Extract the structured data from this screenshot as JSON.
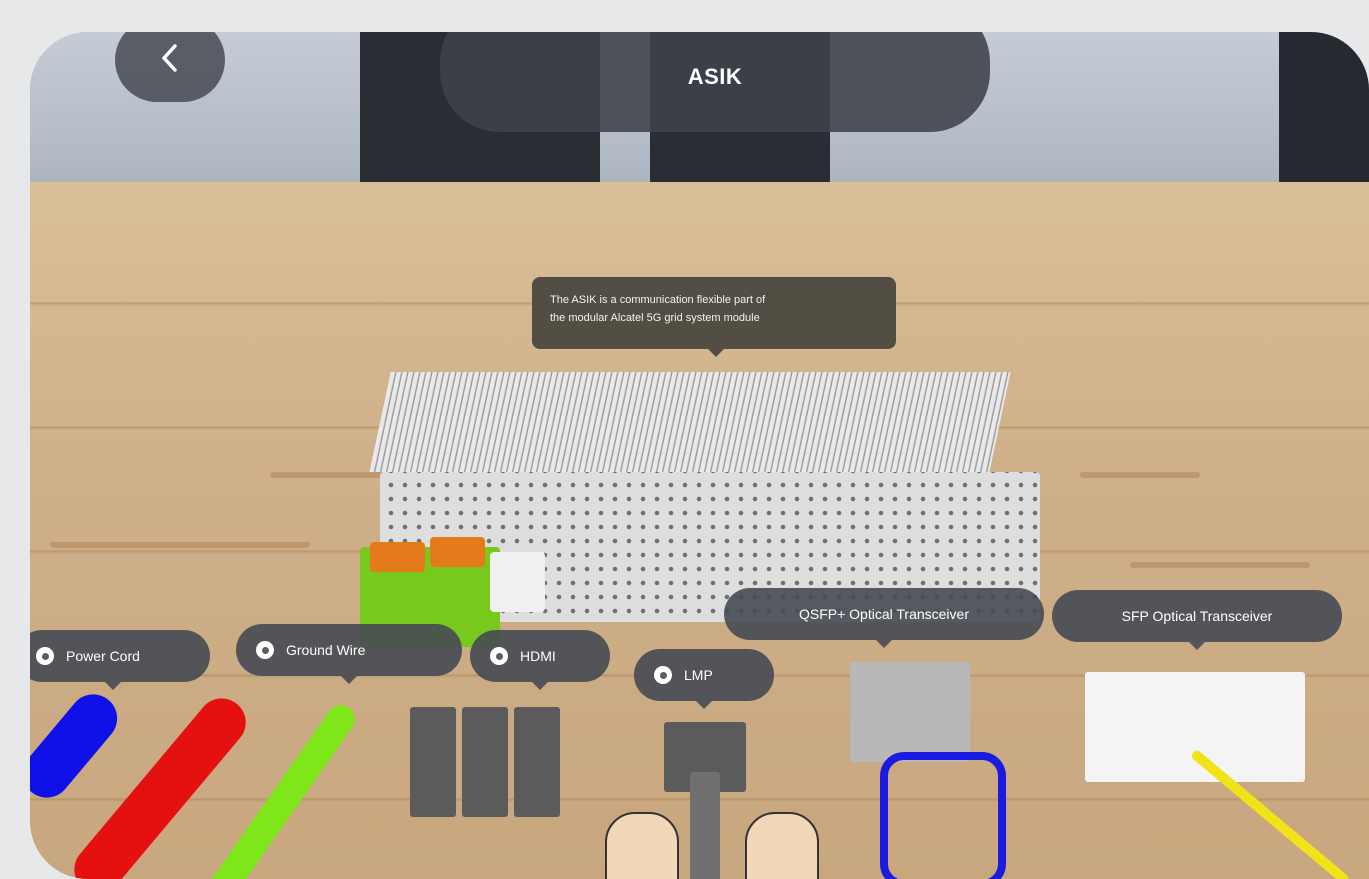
{
  "header": {
    "title": "ASIK",
    "back_icon": "chevron-left-icon"
  },
  "tooltip": {
    "line1": "The ASIK is a communication flexible part of",
    "line2": "the modular Alcatel 5G grid system module"
  },
  "labels": {
    "power_cord": "Power Cord",
    "ground_wire": "Ground Wire",
    "hdmi": "HDMI",
    "lmp": "LMP",
    "qsfp": "QSFP+ Optical Transceiver",
    "sfp": "SFP Optical Transceiver"
  },
  "colors": {
    "power_blue": "#1010e8",
    "power_red": "#e51010",
    "ground_green": "#7fe61a",
    "terminal_orange": "#e57a1a",
    "terminal_green": "#78c81e",
    "fiber_yellow": "#f2e21a",
    "qsfp_loop_blue": "#1a1ae0"
  }
}
